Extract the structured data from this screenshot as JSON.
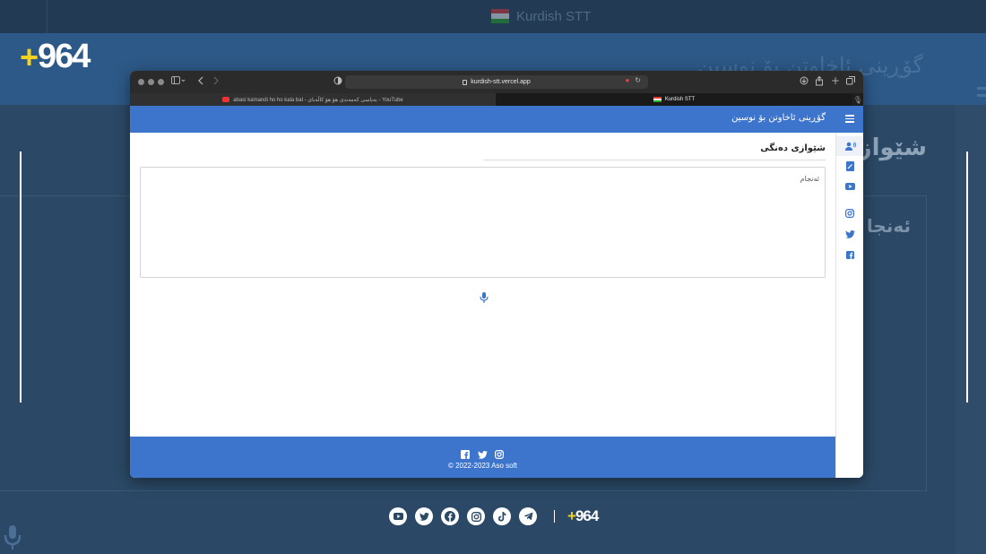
{
  "background": {
    "tab_title": "Kurdish STT",
    "header_text": "گۆڕینی ئاخاوتن بۆ نوسین",
    "side_text": "شێوازی",
    "side_text2": "ئەنجا"
  },
  "brand": {
    "logo_plus": "+",
    "logo_number": "964",
    "accent_color": "#f4d21f"
  },
  "browser": {
    "url": "kurdish-stt.vercel.app",
    "tabs": [
      {
        "label": "abasi kamandi ho ho kala bal - بەیاسی کەمەندی هۆ هۆ کاڵەبای - YouTube",
        "icon": "youtube-icon"
      },
      {
        "label": "Kurdish STT",
        "icon": "kurdistan-flag-icon"
      }
    ]
  },
  "app": {
    "title": "گۆڕینی ئاخاوتن بۆ نوسین",
    "header_color": "#3e75cc",
    "section_title": "شێوازی دەنگی",
    "result_label": "ئەنجام",
    "sidebar_icons": [
      "voice-user-icon",
      "document-icon",
      "youtube-icon",
      "instagram-icon",
      "twitter-icon",
      "facebook-icon"
    ],
    "footer": {
      "icons": [
        "facebook-icon",
        "twitter-icon",
        "instagram-icon"
      ],
      "copyright": "© 2022-2023 Aso soft"
    }
  },
  "social_bar": {
    "icons": [
      "youtube-icon",
      "twitter-icon",
      "facebook-icon",
      "instagram-icon",
      "tiktok-icon",
      "telegram-icon"
    ],
    "logo_plus": "+",
    "logo_number": "964"
  }
}
